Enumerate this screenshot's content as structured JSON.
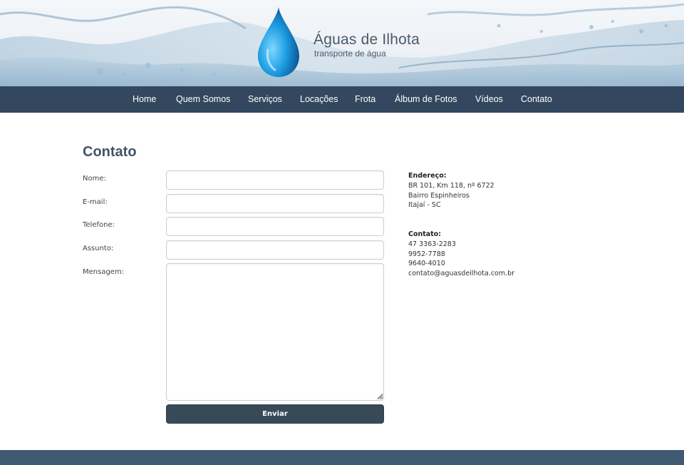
{
  "header": {
    "brand_name": "Águas de Ilhota",
    "brand_tagline": "transporte de água",
    "logo_icon": "water-drop-icon"
  },
  "nav": {
    "items": [
      {
        "label": "Home"
      },
      {
        "label": "Quem Somos"
      },
      {
        "label": "Serviços"
      },
      {
        "label": "Locações"
      },
      {
        "label": "Frota"
      },
      {
        "label": "Álbum de Fotos"
      },
      {
        "label": "Vídeos"
      },
      {
        "label": "Contato"
      }
    ]
  },
  "page": {
    "title": "Contato"
  },
  "form": {
    "fields": [
      {
        "label": "Nome:",
        "value": ""
      },
      {
        "label": "E-mail:",
        "value": ""
      },
      {
        "label": "Telefone:",
        "value": ""
      },
      {
        "label": "Assunto:",
        "value": ""
      },
      {
        "label": "Mensagem:",
        "value": ""
      }
    ],
    "submit_label": "Enviar"
  },
  "contact_info": {
    "address_heading": "Endereço:",
    "address_lines": [
      "BR 101, Km 118, nº 6722",
      "Bairro Espinheiros",
      "Itajaí - SC"
    ],
    "contact_heading": "Contato:",
    "contact_lines": [
      "47 3363-2283",
      "9952-7788",
      "9640-4010",
      "contato@aguasdeilhota.com.br"
    ]
  },
  "colors": {
    "nav_bg": "#33485e",
    "button_bg": "#384a57",
    "title": "#425466",
    "footer_bg": "#415a73"
  }
}
